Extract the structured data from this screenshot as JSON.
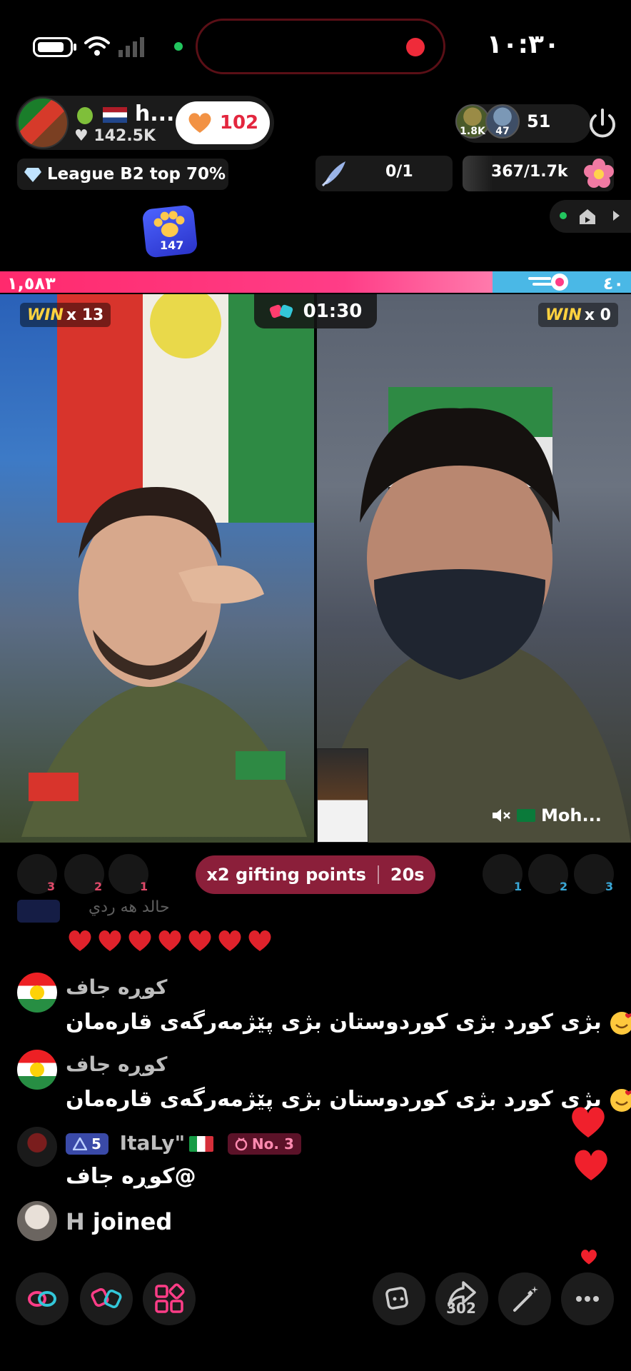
{
  "status_bar": {
    "time": "١٠:٣٠"
  },
  "host": {
    "name": "h...",
    "likes": "142.5K",
    "follow_count": "102"
  },
  "viewers": {
    "avatar1_badge": "1.8K",
    "avatar2_badge": "47",
    "count": "51"
  },
  "league": {
    "text": "League B2 top 70%"
  },
  "quest": {
    "value": "0/1"
  },
  "score_pill": {
    "value": "367/1.7k"
  },
  "paw_badge": {
    "count": "147"
  },
  "battle": {
    "left_score": "١,٥٨٣",
    "right_score": "٤٠",
    "left_share": 0.78,
    "timer": "01:30",
    "left_win_count": "x 13",
    "right_win_count": "x 0",
    "win_label": "WIN"
  },
  "right_host": {
    "name": "Moh..."
  },
  "gifting": {
    "label": "x2 gifting points",
    "timer": "20s"
  },
  "ranks_left": [
    "3",
    "2",
    "1"
  ],
  "ranks_right": [
    "1",
    "2",
    "3"
  ],
  "chat": {
    "faded_name": "حالد هه ردي",
    "messages": [
      {
        "name": "کوڕە جاف",
        "text": "بژی کورد بژی کوردوستان بژی پێژمەرگەی قارەمان"
      },
      {
        "name": "کوڕە جاف",
        "text": "بژی کورد بژی کوردوستان بژی پێژمەرگەی قارەمان"
      },
      {
        "name": "ItaLy\"",
        "level": "5",
        "rank": "No. 3",
        "text": "کوڕە جاف@"
      }
    ],
    "joined": {
      "name": "H",
      "suffix": "joined"
    }
  },
  "bottom_bar": {
    "share_count": "302"
  },
  "colors": {
    "accent_pink": "#ff2a6d",
    "battle_blue": "#4ab8e6",
    "gifting_bg": "#8b1f3a"
  }
}
